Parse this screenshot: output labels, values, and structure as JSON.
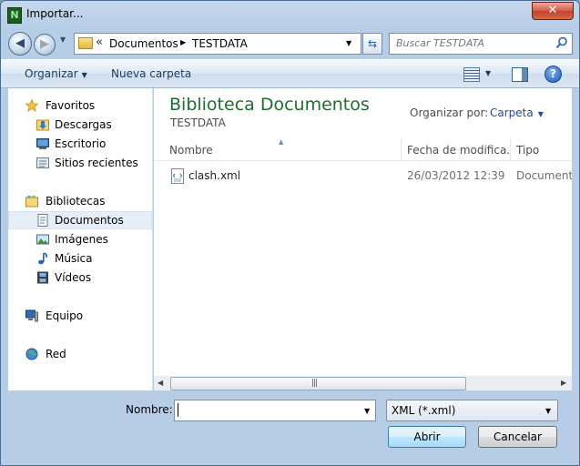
{
  "window": {
    "title": "Importar...",
    "close_glyph": "✕"
  },
  "navbar": {
    "back_glyph": "◀",
    "forward_glyph": "▶",
    "breadcrumb_prefix": "«",
    "breadcrumb": [
      "Documentos",
      "TESTDATA"
    ],
    "search_placeholder": "Buscar TESTDATA"
  },
  "toolbar": {
    "organize_label": "Organizar",
    "new_folder_label": "Nueva carpeta",
    "help_glyph": "?"
  },
  "sidebar": {
    "items": [
      {
        "label": "Favoritos",
        "icon": "star-icon",
        "kind": "header"
      },
      {
        "label": "Descargas",
        "icon": "downloads-folder-icon",
        "kind": "child"
      },
      {
        "label": "Escritorio",
        "icon": "desktop-icon",
        "kind": "child"
      },
      {
        "label": "Sitios recientes",
        "icon": "recent-places-icon",
        "kind": "child"
      },
      {
        "label": "Bibliotecas",
        "icon": "libraries-icon",
        "kind": "header"
      },
      {
        "label": "Documentos",
        "icon": "documents-icon",
        "kind": "child",
        "selected": true
      },
      {
        "label": "Imágenes",
        "icon": "pictures-icon",
        "kind": "child"
      },
      {
        "label": "Música",
        "icon": "music-icon",
        "kind": "child"
      },
      {
        "label": "Vídeos",
        "icon": "videos-icon",
        "kind": "child"
      },
      {
        "label": "Equipo",
        "icon": "computer-icon",
        "kind": "header"
      },
      {
        "label": "Red",
        "icon": "network-icon",
        "kind": "header"
      }
    ]
  },
  "content": {
    "library_title": "Biblioteca Documentos",
    "library_subtitle": "TESTDATA",
    "arrange_label": "Organizar por:",
    "arrange_value": "Carpeta",
    "columns": [
      "Nombre",
      "Fecha de modifica...",
      "Tipo"
    ],
    "files": [
      {
        "name": "clash.xml",
        "modified": "26/03/2012 12:39",
        "type": "Documento XML"
      }
    ]
  },
  "footer": {
    "name_label": "Nombre:",
    "name_value": "",
    "file_type": "XML (*.xml)",
    "open_label": "Abrir",
    "cancel_label": "Cancelar"
  },
  "colors": {
    "library_title": "#1e6e2f",
    "link": "#1e4d93",
    "frame": "#b7cde6"
  }
}
